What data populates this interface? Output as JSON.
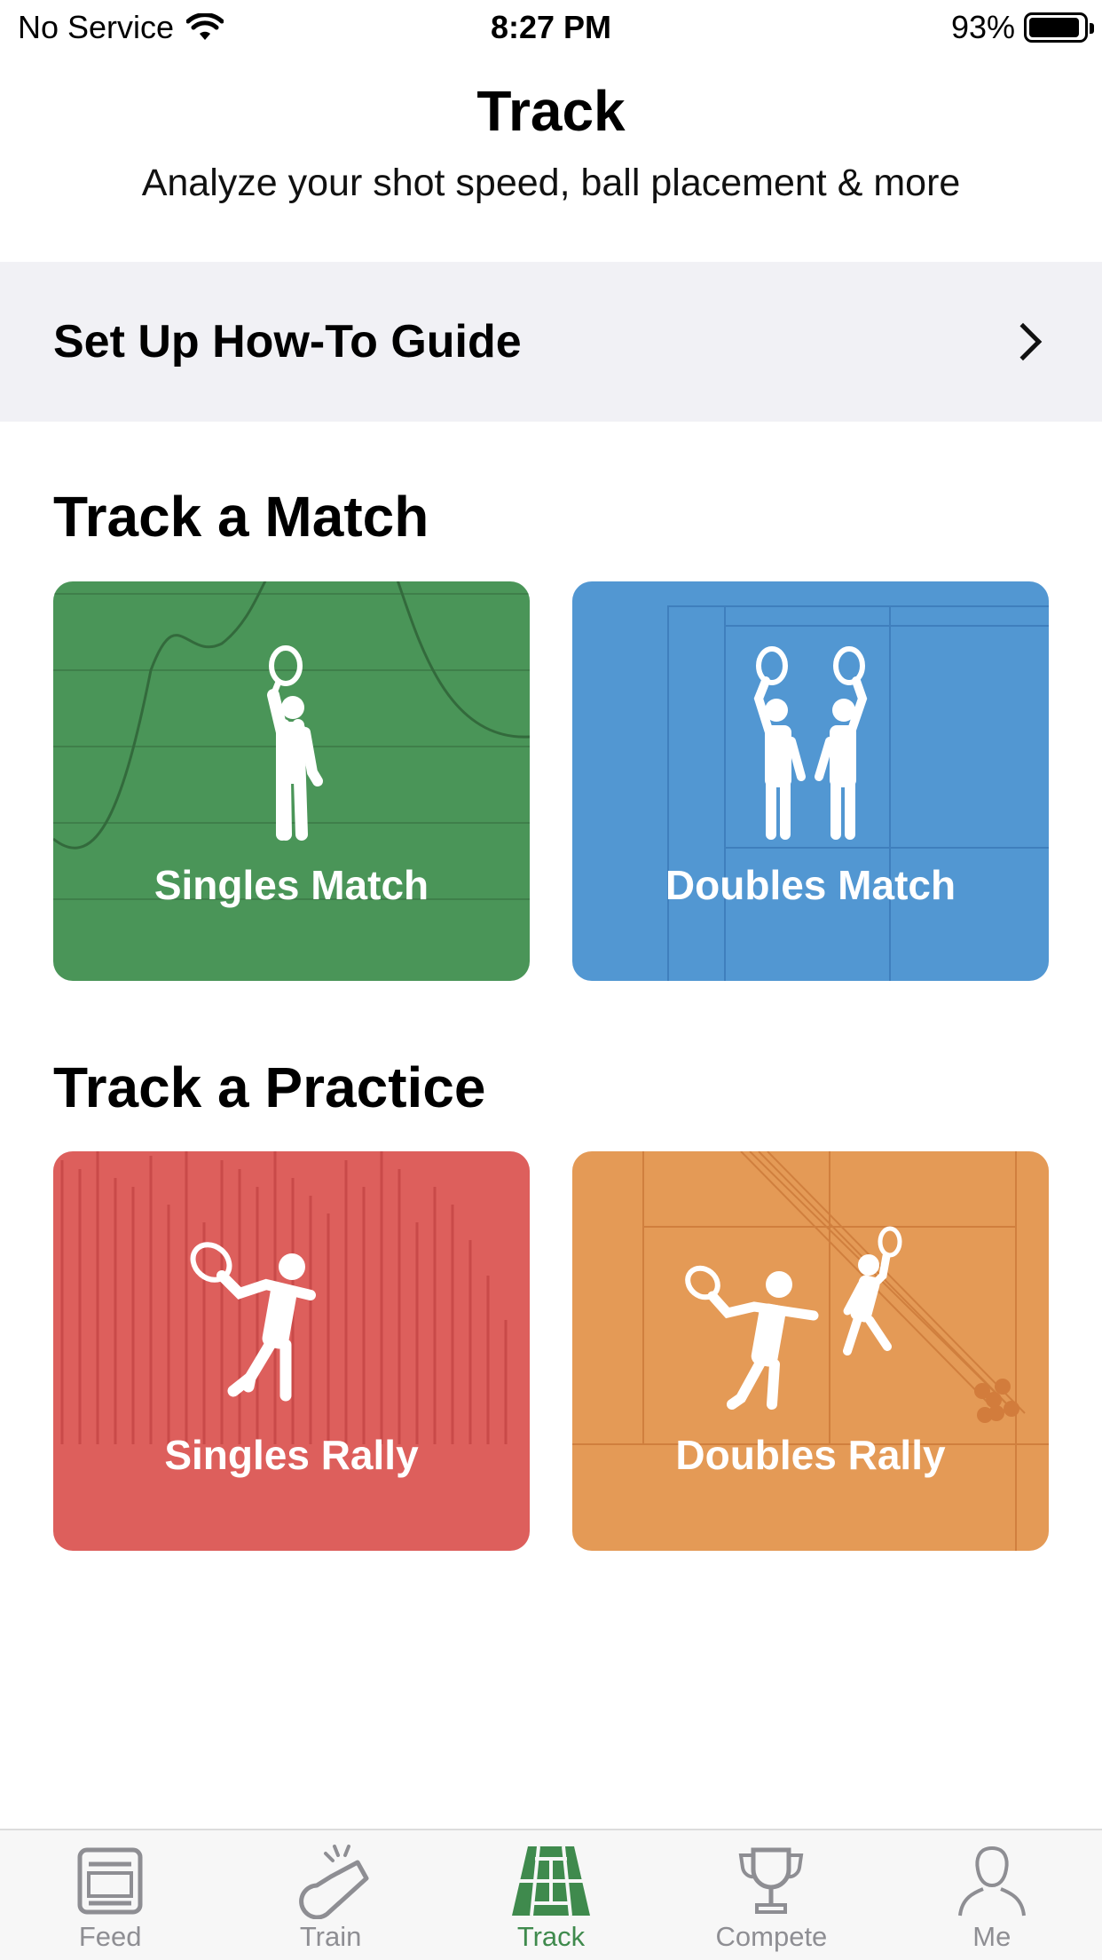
{
  "status_bar": {
    "carrier": "No Service",
    "time": "8:27 PM",
    "battery": "93%",
    "battery_level": 0.93
  },
  "header": {
    "title": "Track",
    "subtitle": "Analyze your shot speed, ball placement & more"
  },
  "guide": {
    "label": "Set Up How-To Guide",
    "icon": "chevron-right-icon"
  },
  "match_section": {
    "title": "Track a Match",
    "cards": [
      {
        "label": "Singles Match",
        "color": "#4a9558",
        "icon": "singles-player-icon"
      },
      {
        "label": "Doubles Match",
        "color": "#5297d2",
        "icon": "doubles-players-icon"
      }
    ]
  },
  "practice_section": {
    "title": "Track a Practice",
    "cards": [
      {
        "label": "Singles Rally",
        "color": "#dd5f5c",
        "icon": "rally-player-icon"
      },
      {
        "label": "Doubles Rally",
        "color": "#e49a56",
        "icon": "doubles-rally-icon"
      }
    ]
  },
  "tab_bar": {
    "active_color": "#3f8a4d",
    "inactive_color": "#8e8e93",
    "tabs": [
      {
        "label": "Feed",
        "icon": "feed-icon"
      },
      {
        "label": "Train",
        "icon": "whistle-icon"
      },
      {
        "label": "Track",
        "icon": "court-icon",
        "active": true
      },
      {
        "label": "Compete",
        "icon": "trophy-icon"
      },
      {
        "label": "Me",
        "icon": "profile-icon"
      }
    ]
  }
}
